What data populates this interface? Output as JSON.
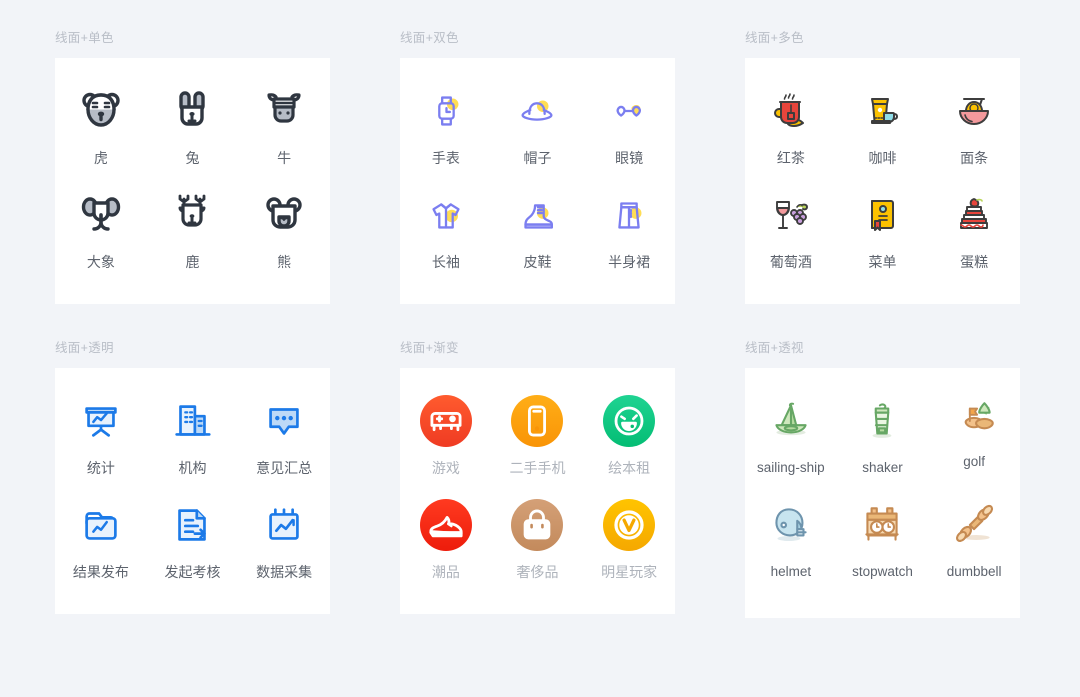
{
  "panels": [
    {
      "label": "线面+单色",
      "style": "mono",
      "colors": {
        "stroke": "#2f3640",
        "fill": "#b6bcc6"
      },
      "items": [
        {
          "caption": "虎",
          "icon": "tiger-icon"
        },
        {
          "caption": "兔",
          "icon": "rabbit-icon"
        },
        {
          "caption": "牛",
          "icon": "ox-icon"
        },
        {
          "caption": "大象",
          "icon": "elephant-icon"
        },
        {
          "caption": "鹿",
          "icon": "deer-icon"
        },
        {
          "caption": "熊",
          "icon": "bear-icon"
        }
      ]
    },
    {
      "label": "线面+双色",
      "style": "duotone",
      "colors": {
        "stroke": "#7b7ef0",
        "accent": "#ffdd55"
      },
      "items": [
        {
          "caption": "手表",
          "icon": "watch-icon"
        },
        {
          "caption": "帽子",
          "icon": "hat-icon"
        },
        {
          "caption": "眼镜",
          "icon": "glasses-icon"
        },
        {
          "caption": "长袖",
          "icon": "long-sleeve-shirt-icon"
        },
        {
          "caption": "皮鞋",
          "icon": "leather-boot-icon"
        },
        {
          "caption": "半身裙",
          "icon": "skirt-icon"
        }
      ]
    },
    {
      "label": "线面+多色",
      "style": "multicolor",
      "colors": {
        "stroke": "#3d3d3d",
        "red": "#e8453c",
        "yellow": "#fcc200",
        "pink": "#f3999c",
        "cyan": "#8fdde8"
      },
      "items": [
        {
          "caption": "红茶",
          "icon": "black-tea-icon"
        },
        {
          "caption": "咖啡",
          "icon": "coffee-icon"
        },
        {
          "caption": "面条",
          "icon": "noodles-icon"
        },
        {
          "caption": "葡萄酒",
          "icon": "wine-icon"
        },
        {
          "caption": "菜单",
          "icon": "menu-book-icon"
        },
        {
          "caption": "蛋糕",
          "icon": "cake-icon"
        }
      ]
    },
    {
      "label": "线面+透明",
      "style": "transparent",
      "colors": {
        "stroke": "#1c7ae8",
        "fill": "#bcd9f7"
      },
      "items": [
        {
          "caption": "统计",
          "icon": "statistics-board-icon"
        },
        {
          "caption": "机构",
          "icon": "organization-building-icon"
        },
        {
          "caption": "意见汇总",
          "icon": "feedback-summary-icon"
        },
        {
          "caption": "结果发布",
          "icon": "result-publish-folder-icon"
        },
        {
          "caption": "发起考核",
          "icon": "start-assessment-icon"
        },
        {
          "caption": "数据采集",
          "icon": "data-collection-icon"
        }
      ]
    },
    {
      "label": "线面+渐变",
      "style": "gradient",
      "colors": {
        "glyph": "#ffffff"
      },
      "items": [
        {
          "caption": "游戏",
          "icon": "gamepad-icon",
          "bg_from": "#ff5b2e",
          "bg_to": "#ef3b23"
        },
        {
          "caption": "二手手机",
          "icon": "second-hand-phone-icon",
          "bg_from": "#ffae17",
          "bg_to": "#f99406"
        },
        {
          "caption": "绘本租",
          "icon": "picture-book-rental-icon",
          "bg_from": "#1fd392",
          "bg_to": "#04bd74"
        },
        {
          "caption": "潮品",
          "icon": "sneaker-icon",
          "bg_from": "#ff3a20",
          "bg_to": "#ed1c0b"
        },
        {
          "caption": "奢侈品",
          "icon": "luxury-bag-icon",
          "bg_from": "#d4a077",
          "bg_to": "#c38a5c"
        },
        {
          "caption": "明星玩家",
          "icon": "star-player-icon",
          "bg_from": "#ffc400",
          "bg_to": "#f5a800"
        }
      ]
    },
    {
      "label": "线面+透视",
      "style": "perspective",
      "colors": {
        "green": "#67a765",
        "green_fill": "#cfe8bd",
        "orange": "#c58a52",
        "orange_fill": "#f3c18a",
        "blue": "#6e94ad",
        "blue_fill": "#c7e4ef"
      },
      "items": [
        {
          "caption": "sailing-ship",
          "icon": "sailing-ship-icon"
        },
        {
          "caption": "shaker",
          "icon": "shaker-icon"
        },
        {
          "caption": "golf",
          "icon": "golf-icon"
        },
        {
          "caption": "helmet",
          "icon": "helmet-icon"
        },
        {
          "caption": "stopwatch",
          "icon": "stopwatch-icon"
        },
        {
          "caption": "dumbbell",
          "icon": "dumbbell-icon"
        }
      ]
    }
  ]
}
